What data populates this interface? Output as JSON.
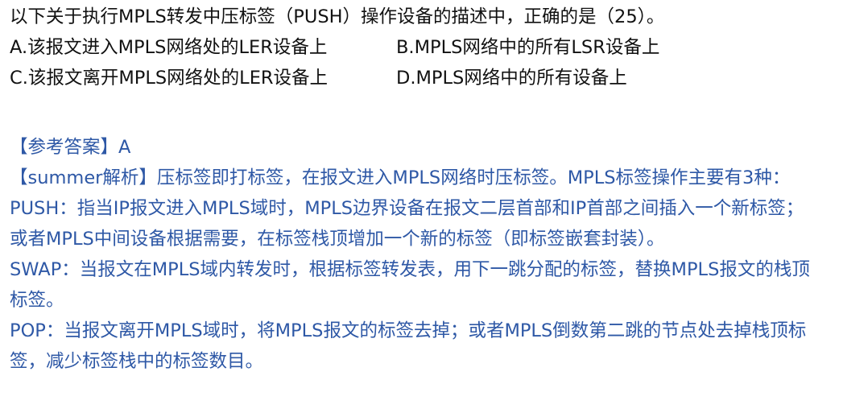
{
  "question": {
    "stem": "以下关于执行MPLS转发中压标签（PUSH）操作设备的描述中，正确的是（25）。",
    "options": {
      "a": "A.该报文进入MPLS网络处的LER设备上",
      "b": "B.MPLS网络中的所有LSR设备上",
      "c": "C.该报文离开MPLS网络处的LER设备上",
      "d": "D.MPLS网络中的所有设备上"
    }
  },
  "answer": {
    "label": "【参考答案】A"
  },
  "analysis": {
    "lines": [
      "【summer解析】压标签即打标签，在报文进入MPLS网络时压标签。MPLS标签操作主要有3种：",
      "PUSH：指当IP报文进入MPLS域时，MPLS边界设备在报文二层首部和IP首部之间插入一个新标签；",
      "或者MPLS中间设备根据需要，在标签栈顶增加一个新的标签（即标签嵌套封装）。",
      "SWAP：当报文在MPLS域内转发时，根据标签转发表，用下一跳分配的标签，替换MPLS报文的栈顶",
      "标签。",
      "POP：当报文离开MPLS域时，将MPLS报文的标签去掉；或者MPLS倒数第二跳的节点处去掉栈顶标",
      "签，减少标签栈中的标签数目。"
    ]
  },
  "colors": {
    "question_text": "#111111",
    "answer_text": "#2e58a6"
  }
}
